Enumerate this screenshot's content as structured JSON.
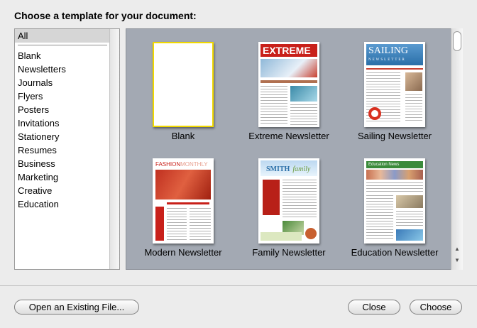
{
  "dialog": {
    "title": "Choose a template for your document:"
  },
  "categories": {
    "selected": "All",
    "items": [
      "Blank",
      "Newsletters",
      "Journals",
      "Flyers",
      "Posters",
      "Invitations",
      "Stationery",
      "Resumes",
      "Business",
      "Marketing",
      "Creative",
      "Education"
    ]
  },
  "templates": [
    {
      "label": "Blank"
    },
    {
      "label": "Extreme Newsletter",
      "masthead": "EXTREME"
    },
    {
      "label": "Sailing Newsletter",
      "masthead": "SAILING",
      "sub": "NEWSLETTER"
    },
    {
      "label": "Modern Newsletter",
      "masthead": "FASHION",
      "masthead2": "MONTHLY"
    },
    {
      "label": "Family Newsletter",
      "masthead": "SMITH",
      "masthead2": "family"
    },
    {
      "label": "Education Newsletter",
      "masthead": "Education News"
    }
  ],
  "buttons": {
    "open_existing": "Open an Existing File...",
    "close": "Close",
    "choose": "Choose"
  },
  "colors": {
    "selection": "#f0d800",
    "panel_bg": "#a3a9b3",
    "extreme_red": "#c8201a",
    "sailing_blue": "#2a6fa8",
    "modern_red": "#c8201a",
    "family_green": "#6a9a3a"
  }
}
